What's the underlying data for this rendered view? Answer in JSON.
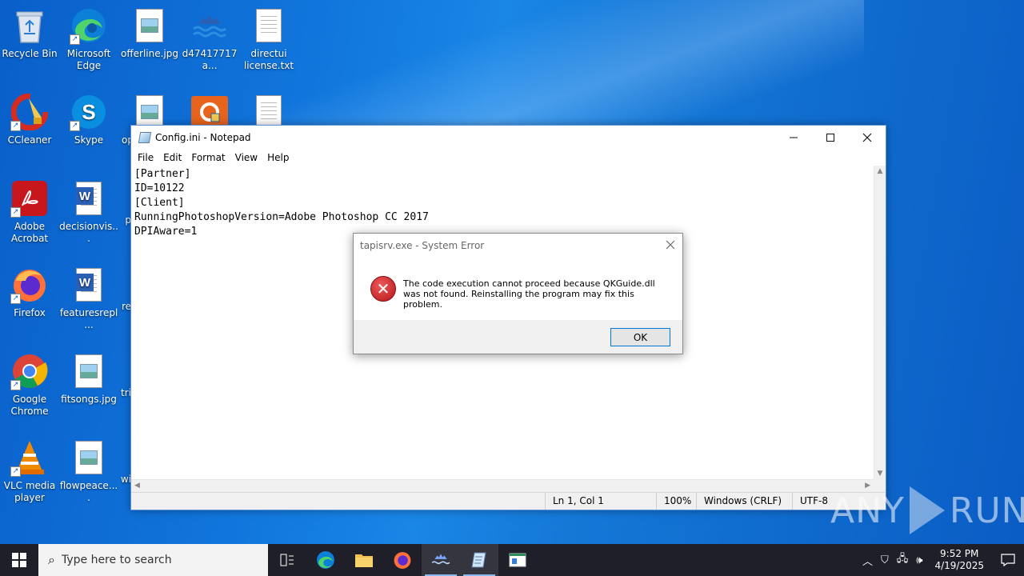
{
  "desktop": {
    "icons": [
      {
        "label": "Recycle Bin"
      },
      {
        "label": "Microsoft Edge"
      },
      {
        "label": "offerline.jpg"
      },
      {
        "label": "d47417717a..."
      },
      {
        "label": "directui license.txt"
      },
      {
        "label": "CCleaner"
      },
      {
        "label": "Skype"
      },
      {
        "label": "op"
      },
      {
        "label": ""
      },
      {
        "label": ""
      },
      {
        "label": "Adobe Acrobat"
      },
      {
        "label": "decisionvis..."
      },
      {
        "label": "p"
      },
      {
        "label": "Firefox"
      },
      {
        "label": "featuresrepl..."
      },
      {
        "label": "re"
      },
      {
        "label": "Google Chrome"
      },
      {
        "label": "fitsongs.jpg"
      },
      {
        "label": "tri"
      },
      {
        "label": "VLC media player"
      },
      {
        "label": "flowpeace...."
      },
      {
        "label": "wi"
      }
    ]
  },
  "notepad": {
    "title": "Config.ini - Notepad",
    "menu": [
      "File",
      "Edit",
      "Format",
      "View",
      "Help"
    ],
    "content": "[Partner]\nID=10122\n[Client]\nRunningPhotoshopVersion=Adobe Photoshop CC 2017\nDPIAware=1",
    "status": {
      "position": "Ln 1, Col 1",
      "zoom": "100%",
      "line_ending": "Windows (CRLF)",
      "encoding": "UTF-8"
    }
  },
  "dialog": {
    "title": "tapisrv.exe - System Error",
    "message": "The code execution cannot proceed because QKGuide.dll was not found. Reinstalling the program may fix this problem.",
    "ok_label": "OK"
  },
  "watermark": {
    "left": "ANY",
    "right": "RUN"
  },
  "taskbar": {
    "search_placeholder": "Type here to search",
    "time": "9:52 PM",
    "date": "4/19/2025"
  },
  "colors": {
    "desktop_blue": "#0a5fc9",
    "taskbar": "#1f1f2a",
    "dialog_button_border": "#0078d7",
    "error_red": "#c42b1c"
  }
}
